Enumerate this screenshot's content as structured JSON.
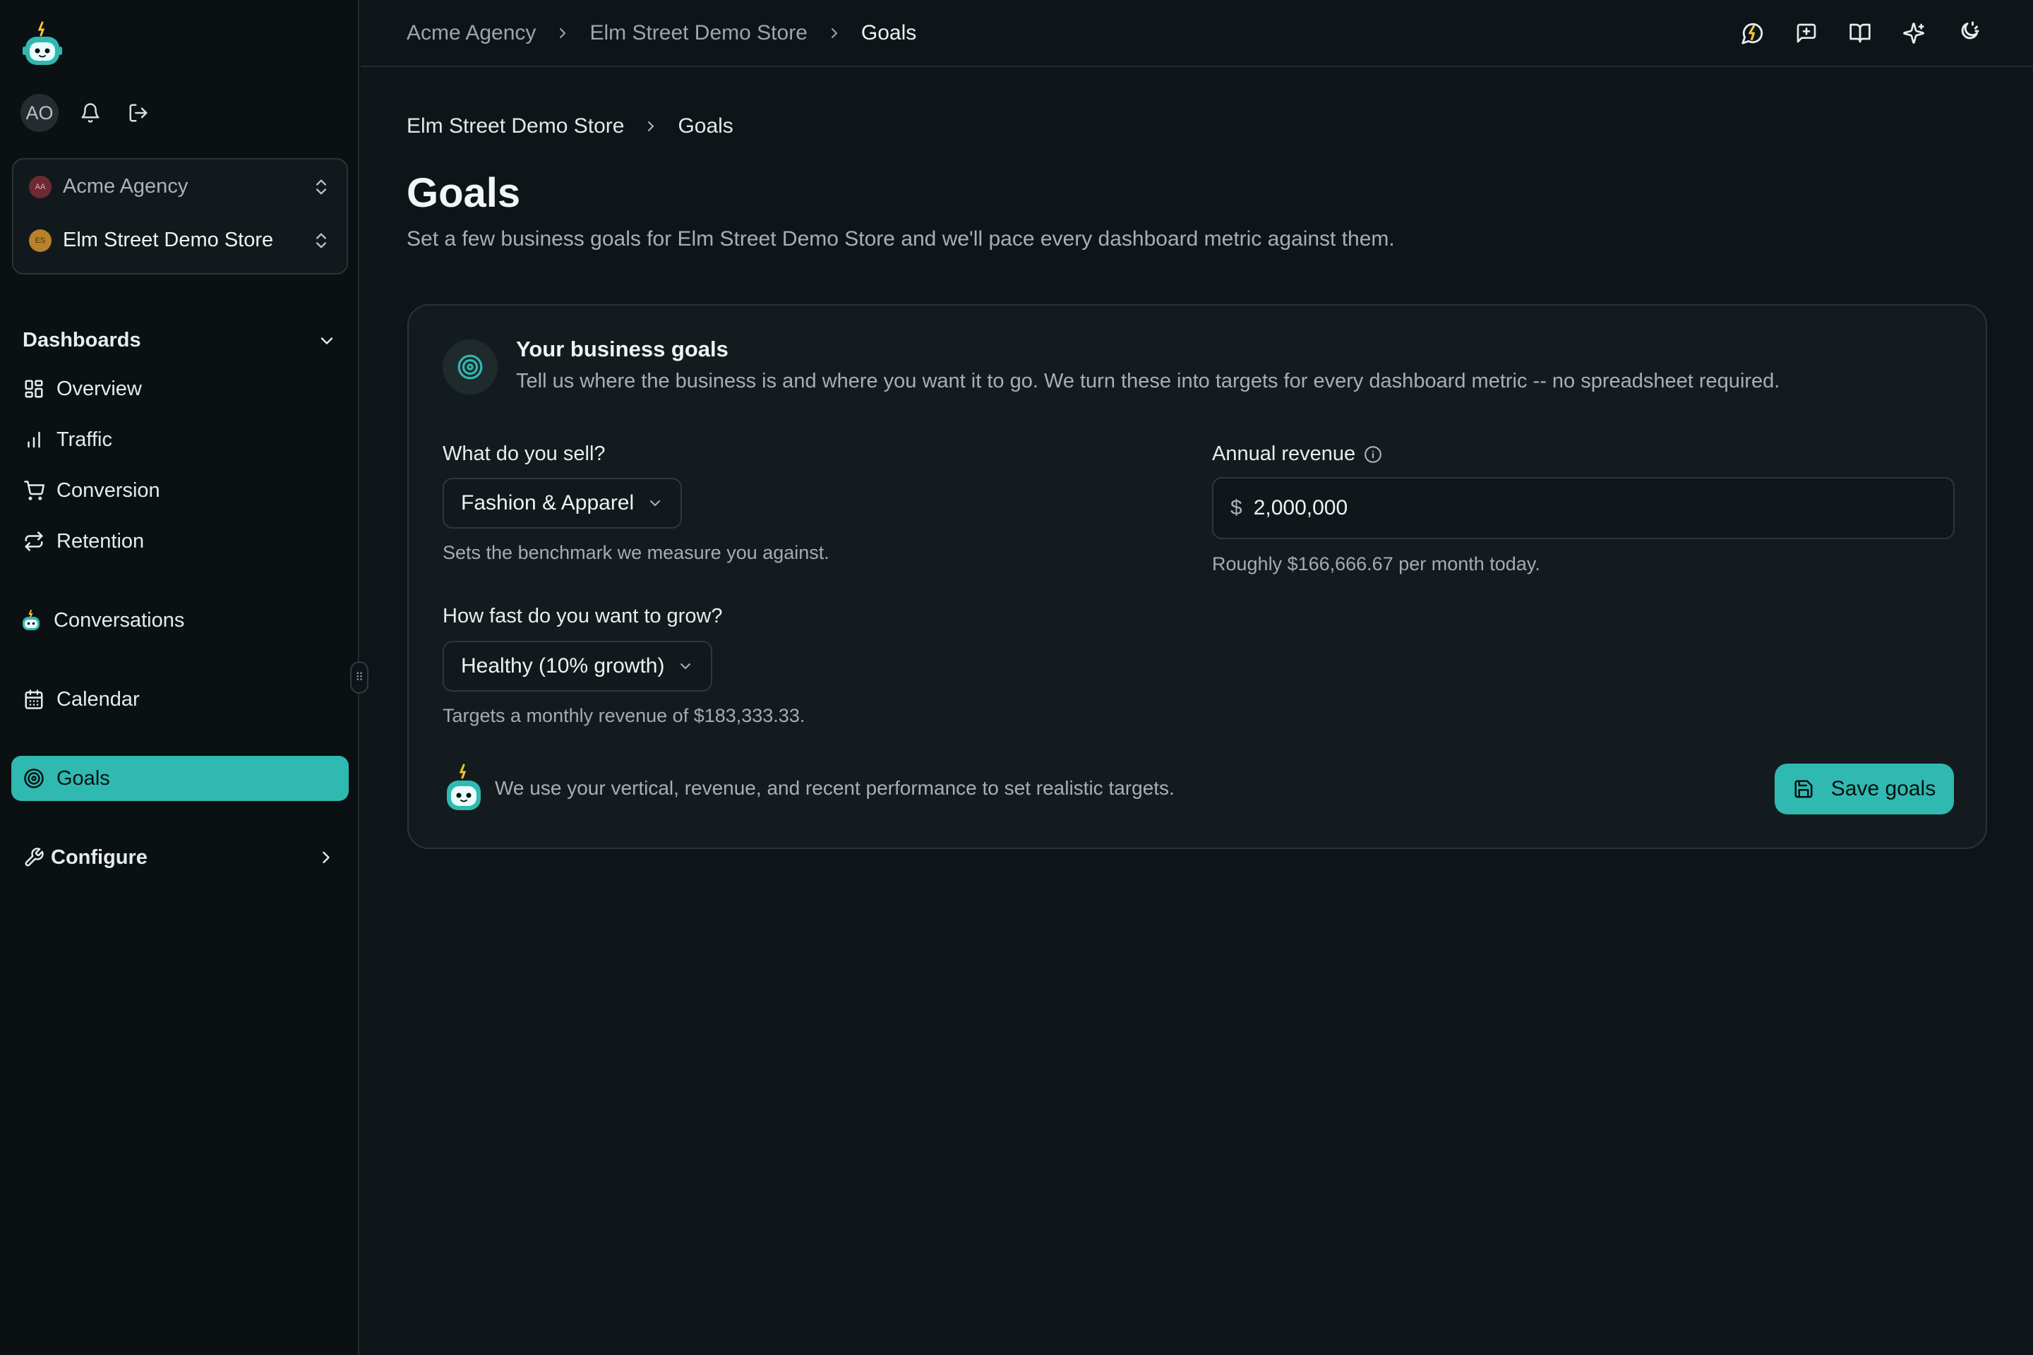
{
  "user": {
    "initials": "AO"
  },
  "switcher": {
    "agency": {
      "badge": "AA",
      "name": "Acme Agency",
      "color": "#d9485f"
    },
    "store": {
      "badge": "ES",
      "name": "Elm Street Demo Store",
      "color": "#c9902c"
    }
  },
  "sidebar": {
    "section_label": "Dashboards",
    "items": [
      {
        "label": "Overview",
        "icon": "grid-icon"
      },
      {
        "label": "Traffic",
        "icon": "bar-chart-icon"
      },
      {
        "label": "Conversion",
        "icon": "cart-icon"
      },
      {
        "label": "Retention",
        "icon": "repeat-icon"
      },
      {
        "label": "Conversations",
        "icon": "bot-icon"
      },
      {
        "label": "Calendar",
        "icon": "calendar-icon"
      },
      {
        "label": "Goals",
        "icon": "target-icon",
        "active": true
      },
      {
        "label": "Configure",
        "icon": "wrench-icon"
      }
    ]
  },
  "topbar": {
    "breadcrumb": [
      "Acme Agency",
      "Elm Street Demo Store",
      "Goals"
    ],
    "actions": [
      "lightning-chat-icon",
      "message-plus-icon",
      "book-icon",
      "sparkles-icon",
      "theme-toggle-icon"
    ]
  },
  "page": {
    "breadcrumb": [
      "Elm Street Demo Store",
      "Goals"
    ],
    "title": "Goals",
    "subtitle": "Set a few business goals for Elm Street Demo Store and we'll pace every dashboard metric against them."
  },
  "card": {
    "title": "Your business goals",
    "description": "Tell us where the business is and where you want it to go. We turn these into targets for every dashboard metric -- no spreadsheet required.",
    "vertical": {
      "label": "What do you sell?",
      "value": "Fashion & Apparel",
      "help": "Sets the benchmark we measure you against."
    },
    "growth": {
      "label": "How fast do you want to grow?",
      "value": "Healthy (10% growth)",
      "help": "Targets a monthly revenue of $183,333.33."
    },
    "revenue": {
      "label": "Annual revenue",
      "currency": "$",
      "value": "2,000,000",
      "help": "Roughly $166,666.67 per month today."
    },
    "footer_note": "We use your vertical, revenue, and recent performance to set realistic targets.",
    "save_label": "Save goals"
  },
  "colors": {
    "accent": "#2fb9b1",
    "background": "#0e1518",
    "sidebar": "#0b1013"
  }
}
